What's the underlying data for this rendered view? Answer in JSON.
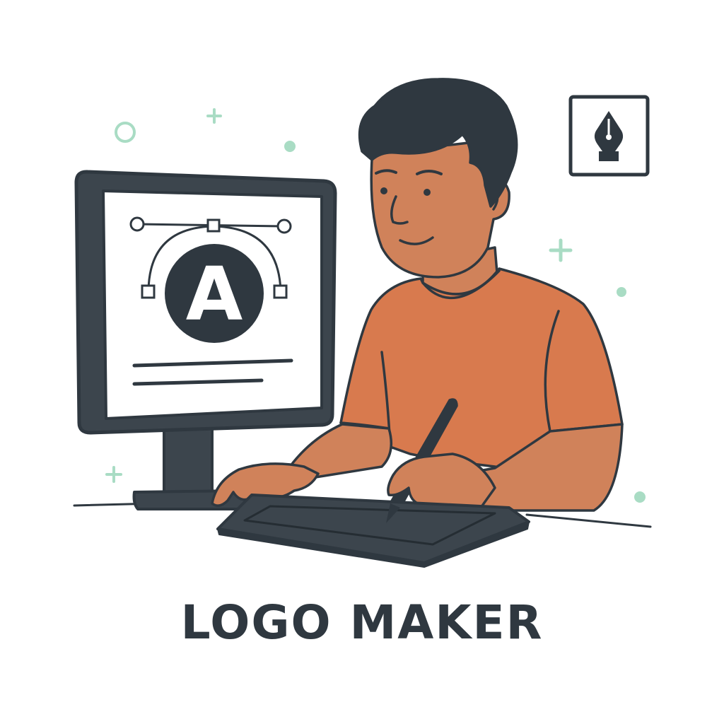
{
  "title": "LOGO MAKER",
  "monitor": {
    "logo_letter": "A"
  },
  "icons": {
    "badge": "pen-nib-icon",
    "decorations": [
      "circle-outline",
      "plus-sparkle",
      "dot"
    ]
  },
  "colors": {
    "outline": "#2f3840",
    "skin": "#d0825a",
    "shirt": "#d87a4e",
    "hair": "#2f3840",
    "screen": "#ffffff",
    "accent_mint": "#a9dcc4",
    "background": "#ffffff"
  }
}
